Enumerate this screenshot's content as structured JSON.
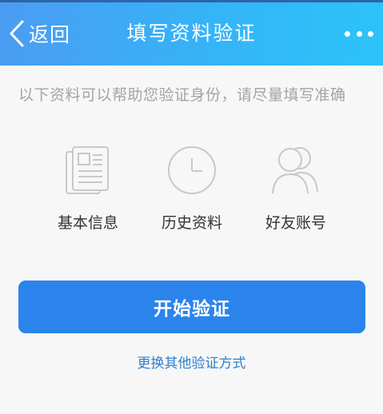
{
  "header": {
    "back_label": "返回",
    "title": "填写资料验证",
    "back_icon": "chevron-left-icon",
    "more_icon": "more-horizontal-icon"
  },
  "hint": "以下资料可以帮助您验证身份，请尽量填写准确",
  "options": [
    {
      "label": "基本信息",
      "icon": "document-icon"
    },
    {
      "label": "历史资料",
      "icon": "clock-icon"
    },
    {
      "label": "好友账号",
      "icon": "friends-icon"
    }
  ],
  "start_button": "开始验证",
  "alt_link": "更换其他验证方式",
  "colors": {
    "header_start": "#4b9cf3",
    "header_end": "#2cc3f8",
    "button": "#2a84ec",
    "link": "#2f7fcf",
    "hint_text": "#a4a4a4",
    "icon_gray": "#c8c8c8"
  }
}
